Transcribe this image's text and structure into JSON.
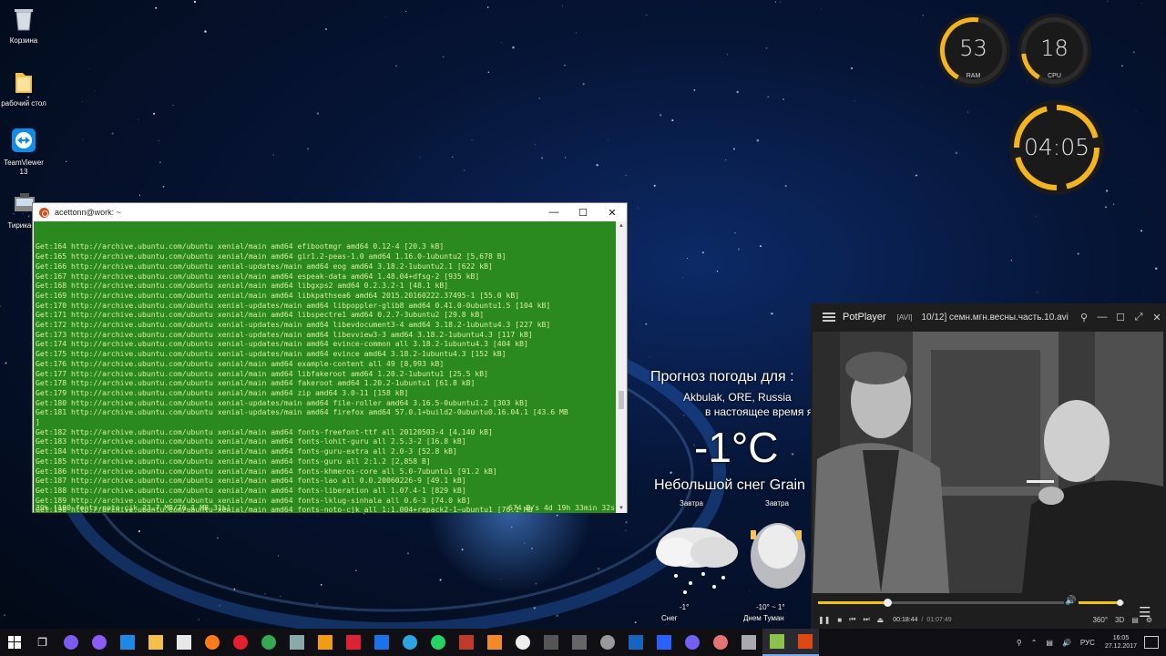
{
  "desktop_icons": [
    {
      "label": "Корзина",
      "icon": "recycle-bin-icon"
    },
    {
      "label": "рабочий стол",
      "icon": "folder-icon"
    },
    {
      "label": "TeamViewer 13",
      "icon": "teamviewer-icon"
    },
    {
      "label": "Тирика-М",
      "icon": "tirika-icon"
    }
  ],
  "gauges": {
    "ram": {
      "value": "53",
      "label": "RAM",
      "percent": 53
    },
    "cpu": {
      "value": "18",
      "label": "CPU",
      "percent": 18
    },
    "clock": {
      "value": "04:05"
    }
  },
  "weather": {
    "title": "Прогноз погоды для :",
    "location": "Akbulak, ORE, Russia",
    "now_label": "в настоящее время я",
    "temperature": "-1°C",
    "description": "Небольшой снег Grain",
    "forecast": [
      {
        "day": "Завтра",
        "temp": "-1°",
        "cond": "Снег"
      },
      {
        "day": "Завтра",
        "temp": "-10° ~ 1°",
        "cond": "Днем Туман"
      }
    ]
  },
  "terminal": {
    "title": "acettonn@work: ~",
    "lines": [
      "Get:164 http://archive.ubuntu.com/ubuntu xenial/main amd64 efibootmgr amd64 0.12-4 [20.3 kB]",
      "Get:165 http://archive.ubuntu.com/ubuntu xenial/main amd64 gir1.2-peas-1.0 amd64 1.16.0-1ubuntu2 [5,678 B]",
      "Get:166 http://archive.ubuntu.com/ubuntu xenial-updates/main amd64 eog amd64 3.18.2-1ubuntu2.1 [622 kB]",
      "Get:167 http://archive.ubuntu.com/ubuntu xenial/main amd64 espeak-data amd64 1.48.04+dfsg-2 [935 kB]",
      "Get:168 http://archive.ubuntu.com/ubuntu xenial/main amd64 libgxps2 amd64 0.2.3.2-1 [48.1 kB]",
      "Get:169 http://archive.ubuntu.com/ubuntu xenial/main amd64 libkpathsea6 amd64 2015.20160222.37495-1 [55.0 kB]",
      "Get:170 http://archive.ubuntu.com/ubuntu xenial-updates/main amd64 libpoppler-glib8 amd64 0.41.0-0ubuntu1.5 [104 kB]",
      "Get:171 http://archive.ubuntu.com/ubuntu xenial/main amd64 libspectre1 amd64 0.2.7-3ubuntu2 [29.8 kB]",
      "Get:172 http://archive.ubuntu.com/ubuntu xenial-updates/main amd64 libevdocument3-4 amd64 3.18.2-1ubuntu4.3 [227 kB]",
      "Get:173 http://archive.ubuntu.com/ubuntu xenial-updates/main amd64 libevview3-3 amd64 3.18.2-1ubuntu4.3 [117 kB]",
      "Get:174 http://archive.ubuntu.com/ubuntu xenial-updates/main amd64 evince-common all 3.18.2-1ubuntu4.3 [404 kB]",
      "Get:175 http://archive.ubuntu.com/ubuntu xenial-updates/main amd64 evince amd64 3.18.2-1ubuntu4.3 [152 kB]",
      "Get:176 http://archive.ubuntu.com/ubuntu xenial/main amd64 example-content all 49 [8,993 kB]",
      "Get:177 http://archive.ubuntu.com/ubuntu xenial/main amd64 libfakeroot amd64 1.20.2-1ubuntu1 [25.5 kB]",
      "Get:178 http://archive.ubuntu.com/ubuntu xenial/main amd64 fakeroot amd64 1.20.2-1ubuntu1 [61.8 kB]",
      "Get:179 http://archive.ubuntu.com/ubuntu xenial/main amd64 zip amd64 3.0-11 [158 kB]",
      "Get:180 http://archive.ubuntu.com/ubuntu xenial-updates/main amd64 file-roller amd64 3.16.5-0ubuntu1.2 [303 kB]",
      "Get:181 http://archive.ubuntu.com/ubuntu xenial-updates/main amd64 firefox amd64 57.0.1+build2-0ubuntu0.16.04.1 [43.6 MB",
      "]",
      "Get:182 http://archive.ubuntu.com/ubuntu xenial/main amd64 fonts-freefont-ttf all 20120503-4 [4,140 kB]",
      "Get:183 http://archive.ubuntu.com/ubuntu xenial/main amd64 fonts-lohit-guru all 2.5.3-2 [16.8 kB]",
      "Get:184 http://archive.ubuntu.com/ubuntu xenial/main amd64 fonts-guru-extra all 2.0-3 [52.8 kB]",
      "Get:185 http://archive.ubuntu.com/ubuntu xenial/main amd64 fonts-guru all 2:1.2 [2,858 B]",
      "Get:186 http://archive.ubuntu.com/ubuntu xenial/main amd64 fonts-khmeros-core all 5.0-7ubuntu1 [91.2 kB]",
      "Get:187 http://archive.ubuntu.com/ubuntu xenial/main amd64 fonts-lao all 0.0.20060226-9 [49.1 kB]",
      "Get:188 http://archive.ubuntu.com/ubuntu xenial/main amd64 fonts-liberation all 1.07.4-1 [829 kB]",
      "Get:189 http://archive.ubuntu.com/ubuntu xenial/main amd64 fonts-lklug-sinhala all 0.6-3 [74.0 kB]",
      "Get:190 http://archive.ubuntu.com/ubuntu xenial/main amd64 fonts-noto-cjk all 1:1.004+repack2-1~ubuntu1 [76.1 MB",
      "]"
    ],
    "status_left": "39% [190 fonts-noto-cjk 23.7 MB/76.1 MB 31%]",
    "status_right": "674 B/s 4d 19h 33min 32s"
  },
  "player": {
    "app": "PotPlayer",
    "format": "[AVI]",
    "file": "10/12] семн.мгн.весны.часть.10.avi",
    "time_current": "00:18:44",
    "time_total": "01:07:49",
    "progress": 0.28,
    "volume": 0.9,
    "btn_360": "360°",
    "btn_3d": "3D"
  },
  "tray": {
    "lang": "РУС",
    "time": "16:05",
    "date": "27.12.2017"
  },
  "colors": {
    "terminal_bg": "#2a8a1f",
    "gauge_ring": "#f2b521",
    "player_accent": "#f2c40f"
  }
}
